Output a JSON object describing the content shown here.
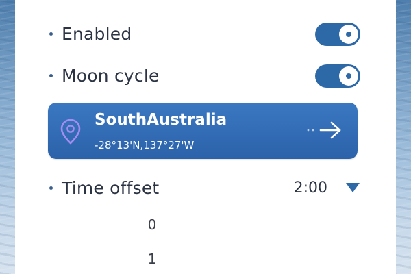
{
  "toggles": {
    "enabled": {
      "label": "Enabled",
      "on": true
    },
    "moon_cycle": {
      "label": "Moon cycle",
      "on": true
    }
  },
  "location": {
    "name": "SouthAustralia",
    "coords": "-28°13'N,137°27'W",
    "pin_icon": "location-pin-icon",
    "arrow_icon": "arrow-right-icon"
  },
  "time_offset": {
    "label": "Time offset",
    "value": "2:00",
    "dropdown_icon": "triangle-down-icon"
  },
  "picker": {
    "items": [
      "0",
      "1"
    ]
  },
  "colors": {
    "accent": "#2d69a7",
    "card_top": "#3a78c2",
    "card_bottom": "#2c62a9",
    "text": "#2c3444"
  }
}
